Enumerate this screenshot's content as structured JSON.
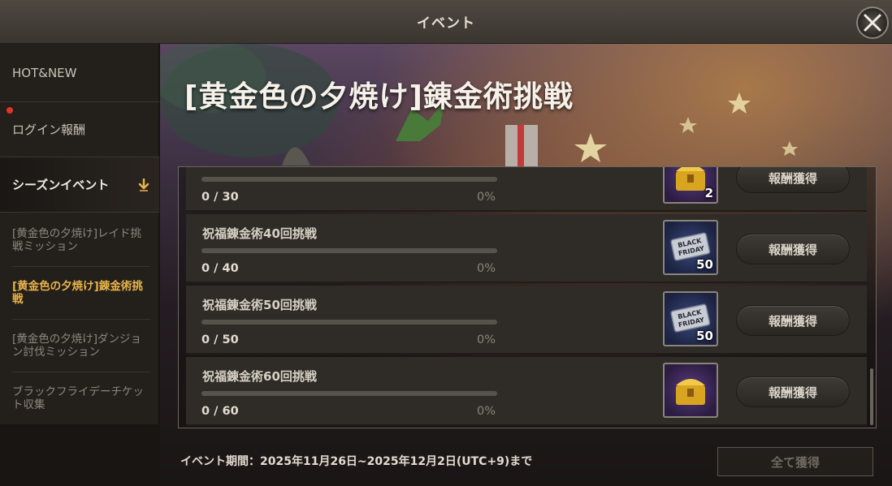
{
  "window": {
    "title": "イベント"
  },
  "sidebar": {
    "hot_new": "HOT&NEW",
    "login_rewards": "ログイン報酬",
    "season_event": "シーズンイベント",
    "sub_items": [
      "[黄金色の夕焼け]レイド挑戦ミッション",
      "[黄金色の夕焼け]錬金術挑戦",
      "[黄金色の夕焼け]ダンジョン討伐ミッション",
      "ブラックフライデーチケット収集"
    ],
    "active_index": 1
  },
  "main": {
    "title": "[黄金色の夕焼け]錬金術挑戦",
    "rows": [
      {
        "label": "",
        "count": "0 / 30",
        "percent": "0%",
        "progress": 0,
        "reward": "gold-chest",
        "qty": "2",
        "button": "報酬獲得"
      },
      {
        "label": "祝福錬金術40回挑戦",
        "count": "0 / 40",
        "percent": "0%",
        "progress": 0,
        "reward": "black-friday-ticket",
        "qty": "50",
        "button": "報酬獲得"
      },
      {
        "label": "祝福錬金術50回挑戦",
        "count": "0 / 50",
        "percent": "0%",
        "progress": 0,
        "reward": "black-friday-ticket",
        "qty": "50",
        "button": "報酬獲得"
      },
      {
        "label": "祝福錬金術60回挑戦",
        "count": "0 / 60",
        "percent": "0%",
        "progress": 0,
        "reward": "gold-chest",
        "qty": "",
        "button": "報酬獲得"
      }
    ],
    "ticket_text": [
      "BLACK",
      "FRIDAY"
    ],
    "period": "イベント期間：2025年11月26日~2025年12月2日(UTC+9)まで",
    "claim_all": "全て獲得"
  },
  "colors": {
    "accent_gold": "#e8b34a",
    "progress_fill": "#d8a946",
    "notification": "#e03524"
  }
}
